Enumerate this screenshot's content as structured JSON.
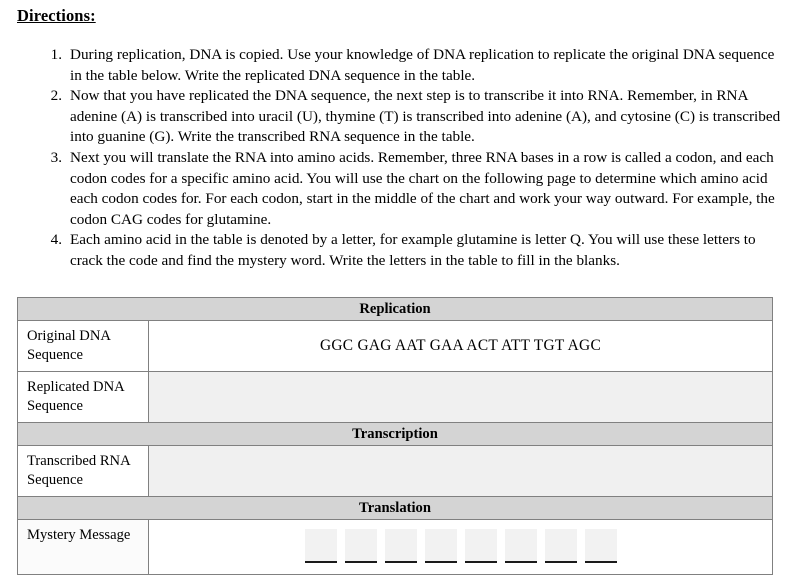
{
  "document": {
    "heading": "Directions:",
    "instructions": [
      {
        "number": "1.",
        "text": "During replication, DNA is copied.  Use your knowledge of DNA replication to replicate the original DNA sequence in the table below.  Write the replicated DNA sequence in the table."
      },
      {
        "number": "2.",
        "text": "Now that you have replicated the DNA sequence, the next step is to transcribe it into RNA.  Remember, in RNA adenine (A) is transcribed into uracil (U), thymine (T) is transcribed into adenine (A), and cytosine (C) is transcribed into guanine (G).  Write the transcribed RNA sequence in the table."
      },
      {
        "number": "3.",
        "text": "Next you will translate the RNA into amino acids.  Remember, three RNA bases in a row is called a codon, and each codon codes for a specific amino acid. You will use the chart on the following page to determine which amino acid each codon codes for.  For each codon, start in the middle of the chart and work your way outward.  For example, the codon CAG codes for glutamine."
      },
      {
        "number": "4.",
        "text": "Each amino acid in the table is denoted by a letter, for example glutamine is letter Q.  You will use these letters to crack the code and find the mystery word.  Write the letters in the table to fill in the blanks."
      }
    ]
  },
  "table": {
    "sections": {
      "replication": "Replication",
      "transcription": "Transcription",
      "translation": "Translation"
    },
    "rows": {
      "original_dna": {
        "label": "Original DNA Sequence",
        "value": "GGC  GAG  AAT  GAA  ACT  ATT  TGT  AGC"
      },
      "replicated_dna": {
        "label": "Replicated DNA Sequence",
        "value": ""
      },
      "transcribed_rna": {
        "label": "Transcribed RNA Sequence",
        "value": ""
      },
      "mystery_message": {
        "label": "Mystery Message",
        "value": "",
        "blank_count": 8
      }
    }
  },
  "colors": {
    "section_header_bg": "#d4d4d4",
    "shaded_cell_bg": "#f0f0f0",
    "border": "#808080",
    "blank_fill": "#f2f2f2",
    "text": "#000000"
  }
}
